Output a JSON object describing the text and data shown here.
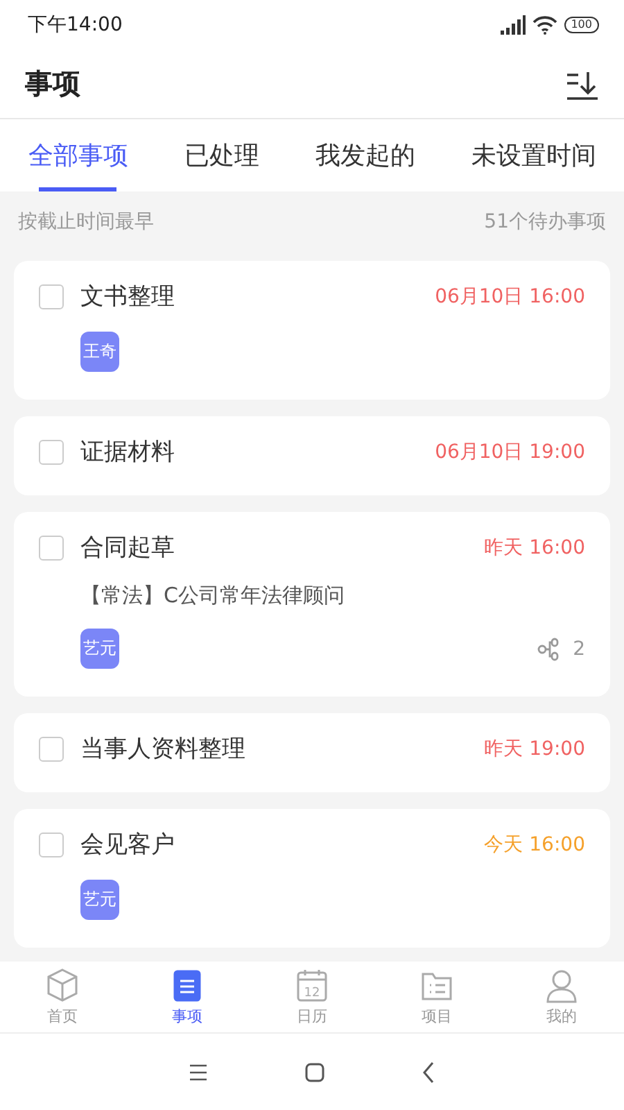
{
  "status_bar": {
    "time": "下午14:00",
    "battery": "100"
  },
  "header": {
    "title": "事项"
  },
  "tabs": [
    {
      "label": "全部事项",
      "selected": true
    },
    {
      "label": "已处理",
      "selected": false
    },
    {
      "label": "我发起的",
      "selected": false
    },
    {
      "label": "未设置时间",
      "selected": false
    }
  ],
  "sort_bar": {
    "order": "按截止时间最早",
    "count": "51个待办事项"
  },
  "tasks": [
    {
      "title": "文书整理",
      "checked": false,
      "due": "06月10日 16:00",
      "color": "#f06262",
      "assignee": "王奇"
    },
    {
      "title": "证据材料",
      "checked": false,
      "due": "06月10日 19:00",
      "color": "#f06262"
    },
    {
      "title": "合同起草",
      "checked": false,
      "due": "昨天 16:00",
      "color": "#f06262",
      "case": "【常法】C公司常年法律顾问",
      "assignee": "艺元",
      "subtasks": "2"
    },
    {
      "title": "当事人资料整理",
      "checked": false,
      "due": "昨天 19:00",
      "color": "#f06262"
    },
    {
      "title": "会见客户",
      "checked": false,
      "due": "今天 16:00",
      "color": "#f5a02a",
      "assignee": "艺元"
    }
  ],
  "bottom_nav": [
    {
      "kind": "home",
      "label": "首页",
      "selected": false
    },
    {
      "kind": "tasks",
      "label": "事项",
      "selected": true
    },
    {
      "kind": "calendar",
      "label": "日历",
      "selected": false,
      "icon_text": "12"
    },
    {
      "kind": "projects",
      "label": "项目",
      "selected": false
    },
    {
      "kind": "profile",
      "label": "我的",
      "selected": false
    }
  ]
}
